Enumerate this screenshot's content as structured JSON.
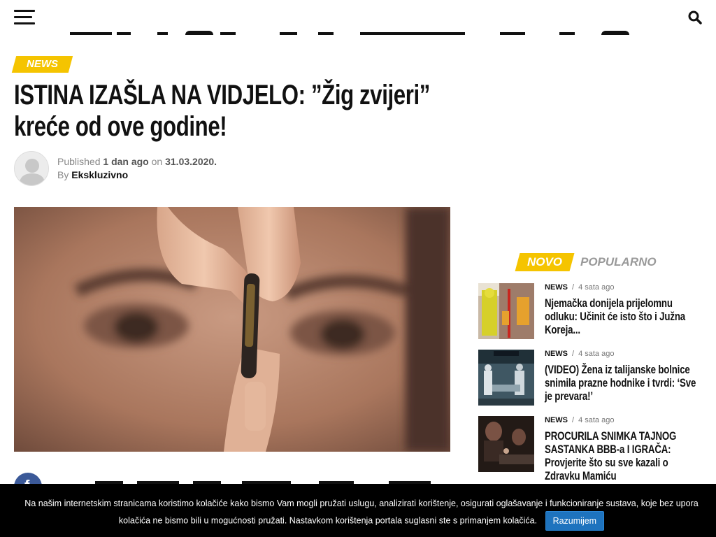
{
  "header": {
    "menu_icon": "hamburger-menu-icon",
    "search_icon": "search-icon"
  },
  "article": {
    "category": "NEWS",
    "title": "ISTINA IZAŠLA NA VIDJELO: ”Žig zvijeri” kreće od ove godine!",
    "published_label": "Published",
    "published_relative": "1 dan ago",
    "on_label": "on",
    "published_date": "31.03.2020.",
    "by_label": "By",
    "author": "Ekskluzivno",
    "share_icon": "facebook-icon",
    "share_letter": "f"
  },
  "sidebar": {
    "tabs": [
      {
        "label": "NOVO",
        "active": true
      },
      {
        "label": "POPULARNO",
        "active": false
      }
    ],
    "items": [
      {
        "category": "NEWS",
        "separator": "/",
        "time": "4 sata ago",
        "title": "Njemačka donijela prijelomnu odluku: Učinit će isto što i Južna Koreja..."
      },
      {
        "category": "NEWS",
        "separator": "/",
        "time": "4 sata ago",
        "title": "(VIDEO) Žena iz talijanske bolnice snimila prazne hodnike i tvrdi: ‘Sve je prevara!’"
      },
      {
        "category": "NEWS",
        "separator": "/",
        "time": "4 sata ago",
        "title": "PROCURILA SNIMKA TAJNOG SASTANKA BBB-a I IGRAČA: Provjerite što su sve kazali o Zdravku Mamiću"
      }
    ]
  },
  "cookie_notice": {
    "text": "Na našim internetskim stranicama koristimo kolačiće kako bismo Vam mogli pružati uslugu, analizirati korištenje, osigurati oglašavanje i funkcioniranje sustava, koje bez upora kolačića ne bismo bili u mogućnosti pružati. Nastavkom korištenja portala suglasni ste s primanjem kolačića.",
    "button_label": "Razumijem"
  },
  "colors": {
    "accent": "#f5c400",
    "facebook": "#3b5998",
    "cookie_button": "#1e73be"
  }
}
